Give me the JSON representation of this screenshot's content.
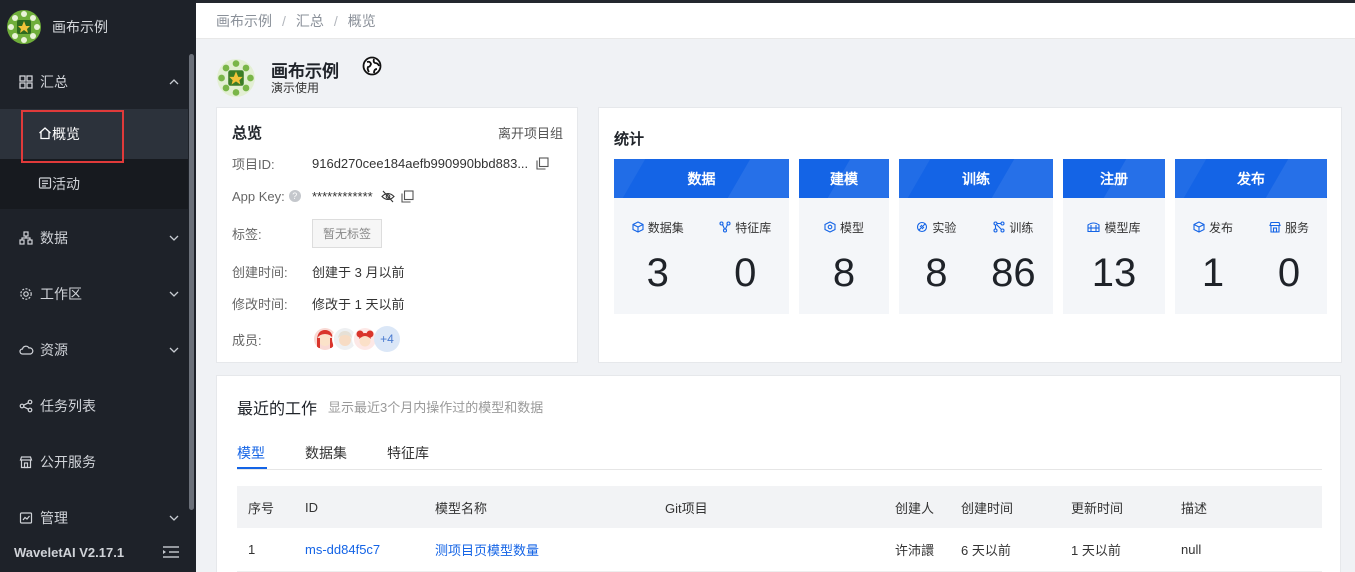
{
  "app": {
    "brand_name": "画布示例",
    "version": "WaveletAI V2.17.1"
  },
  "sidebar": {
    "groups": [
      {
        "label": "汇总",
        "icon": "grid-icon"
      },
      {
        "label": "数据",
        "icon": "data-icon"
      },
      {
        "label": "工作区",
        "icon": "settings-icon"
      },
      {
        "label": "资源",
        "icon": "cloud-icon"
      },
      {
        "label": "任务列表",
        "icon": "nodes-icon"
      },
      {
        "label": "公开服务",
        "icon": "shop-icon"
      },
      {
        "label": "管理",
        "icon": "admin-icon"
      }
    ],
    "sub_items": [
      {
        "label": "概览",
        "icon": "home-icon",
        "active": true
      },
      {
        "label": "活动",
        "icon": "activity-icon"
      }
    ]
  },
  "breadcrumb": [
    "画布示例",
    "汇总",
    "概览"
  ],
  "breadcrumb_sep": "/",
  "project": {
    "title": "画布示例",
    "subtitle": "演示使用"
  },
  "overview": {
    "title": "总览",
    "leave_label": "离开项目组",
    "id_label": "项目ID:",
    "id_value": "916d270cee184aefb990990bbd883...",
    "appkey_label": "App Key:",
    "appkey_value": "************",
    "tags_label": "标签:",
    "tags_value": "暂无标签",
    "created_label": "创建时间:",
    "created_value": "创建于 3 月以前",
    "modified_label": "修改时间:",
    "modified_value": "修改于 1 天以前",
    "members_label": "成员:",
    "members_more": "+4"
  },
  "stats": {
    "title": "统计",
    "accent": "#1464e6",
    "blocks": [
      {
        "head": "数据",
        "items": [
          {
            "label": "数据集",
            "icon": "cube-icon",
            "value": "3"
          },
          {
            "label": "特征库",
            "icon": "share-icon",
            "value": "0"
          }
        ]
      },
      {
        "head": "建模",
        "items": [
          {
            "label": "模型",
            "icon": "model-icon",
            "value": "8"
          }
        ]
      },
      {
        "head": "训练",
        "items": [
          {
            "label": "实验",
            "icon": "experiment-icon",
            "value": "8"
          },
          {
            "label": "训练",
            "icon": "train-icon",
            "value": "86"
          }
        ]
      },
      {
        "head": "注册",
        "items": [
          {
            "label": "模型库",
            "icon": "library-icon",
            "value": "13"
          }
        ]
      },
      {
        "head": "发布",
        "items": [
          {
            "label": "发布",
            "icon": "publish-icon",
            "value": "1"
          },
          {
            "label": "服务",
            "icon": "service-icon",
            "value": "0"
          }
        ]
      }
    ]
  },
  "recent": {
    "title": "最近的工作",
    "subtitle": "显示最近3个月内操作过的模型和数据",
    "tabs": [
      "模型",
      "数据集",
      "特征库"
    ],
    "columns": [
      "序号",
      "ID",
      "模型名称",
      "Git项目",
      "创建人",
      "创建时间",
      "更新时间",
      "描述"
    ],
    "rows": [
      [
        "1",
        "ms-dd84f5c7",
        "测项目页模型数量",
        "",
        "许沛譞",
        "6 天以前",
        "1 天以前",
        "null"
      ]
    ]
  }
}
